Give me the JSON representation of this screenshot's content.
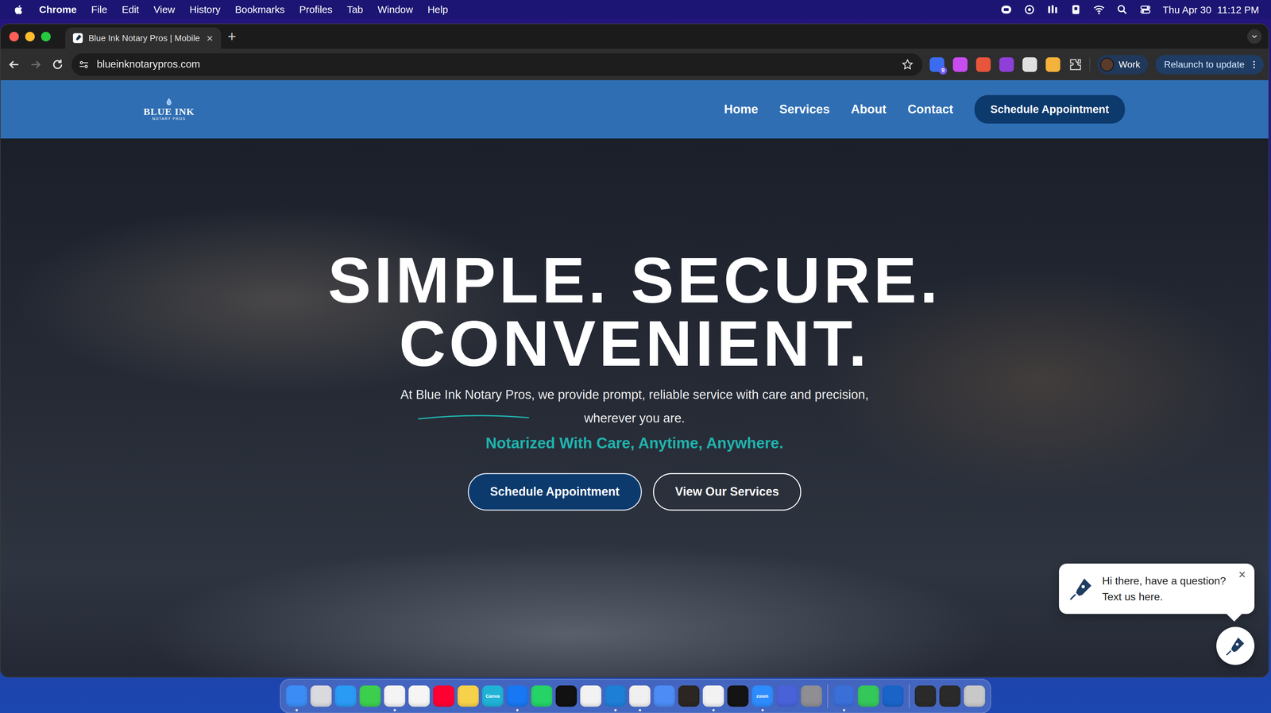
{
  "menubar": {
    "app": "Chrome",
    "menus": [
      "File",
      "Edit",
      "View",
      "History",
      "Bookmarks",
      "Profiles",
      "Tab",
      "Window",
      "Help"
    ],
    "date": "Thu Apr 30",
    "time": "11:12 PM"
  },
  "tabs": [
    {
      "label": "Blue Ink Notary Pros | Mobile",
      "selected": true,
      "close": "×"
    }
  ],
  "new_tab": "+",
  "toolbar": {
    "url": "blueinknotarypros.com",
    "bookmarked": false,
    "forward_enabled": false,
    "extensions": [
      {
        "color": "#3b6cf0",
        "badge": "9"
      },
      {
        "color": "#c84cf0"
      },
      {
        "color": "#e8553a"
      },
      {
        "color": "#8e3fd8"
      },
      {
        "color": "#e0e0e0"
      },
      {
        "color": "#f4b23a"
      }
    ],
    "profile": "Work",
    "update": "Relaunch to update"
  },
  "site": {
    "logo": {
      "name": "BLUE INK",
      "sub": "NOTARY PROS"
    },
    "nav": [
      "Home",
      "Services",
      "About",
      "Contact"
    ],
    "cta": "Schedule Appointment",
    "hero": {
      "headline": [
        "SIMPLE. SECURE.",
        "CONVENIENT."
      ],
      "lead": "At ",
      "brand": "Blue Ink Notary Pros",
      "rest": ", we provide prompt, reliable service with care and precision, wherever you are.",
      "tagline": "Notarized With Care, Anytime, Anywhere.",
      "buttons": [
        "Schedule Appointment",
        "View Our Services"
      ]
    },
    "chat": {
      "lines": [
        "Hi there, have a question?",
        "Text us here."
      ],
      "close": "×"
    }
  },
  "dock": {
    "groups": [
      [
        {
          "color": "#3b8df5",
          "running": true
        },
        {
          "color": "#d9d9de",
          "running": false
        },
        {
          "color": "#2a9bf5",
          "running": false
        },
        {
          "color": "#3ccf4e",
          "running": false
        },
        {
          "color": "#f4f4f4",
          "running": true
        },
        {
          "color": "#f5f5f5",
          "running": false
        },
        {
          "color": "#ff0033",
          "running": false
        },
        {
          "color": "#f7d149",
          "running": false
        },
        {
          "color": "#1fb3d6",
          "running": false,
          "label": "Canva"
        },
        {
          "color": "#1877f2",
          "running": true
        },
        {
          "color": "#25d366",
          "running": false
        },
        {
          "color": "#111111",
          "running": false
        },
        {
          "color": "#f2f2f2",
          "running": false
        },
        {
          "color": "#1e7fd6",
          "running": true
        },
        {
          "color": "#f0f0f0",
          "running": true
        },
        {
          "color": "#4d8cf5",
          "running": false
        },
        {
          "color": "#2b2622",
          "running": false
        },
        {
          "color": "#f2f2f2",
          "running": true
        },
        {
          "color": "#141414",
          "running": false
        },
        {
          "color": "#2d8cff",
          "running": true,
          "label": "zoom"
        },
        {
          "color": "#4a62d8",
          "running": false
        },
        {
          "color": "#8e8e93",
          "running": false
        }
      ],
      [
        {
          "color": "#3a6fd8",
          "running": true
        },
        {
          "color": "#34c759",
          "running": false
        },
        {
          "color": "#1a64c8",
          "running": false
        }
      ],
      [
        {
          "color": "#2a2a2a",
          "running": false
        },
        {
          "color": "#2a2a2a",
          "running": false
        },
        {
          "color": "#c8c8c8",
          "running": false
        }
      ]
    ]
  }
}
